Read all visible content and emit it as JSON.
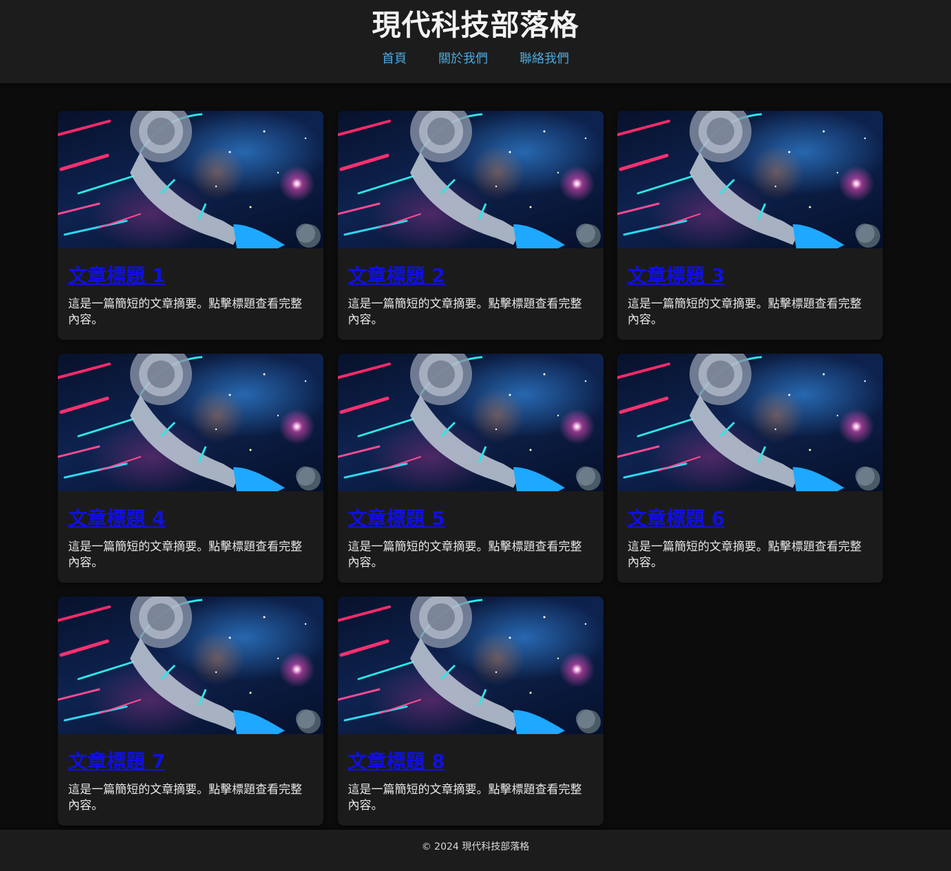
{
  "header": {
    "site_title": "現代科技部落格",
    "nav": [
      {
        "label": "首頁"
      },
      {
        "label": "關於我們"
      },
      {
        "label": "聯絡我們"
      }
    ]
  },
  "colors": {
    "header_bg": "#1c1c1c",
    "page_bg": "#0c0c0c",
    "card_bg": "#1b1b1b",
    "nav_link": "#4fa8dc",
    "post_link": "#1010e0"
  },
  "posts": [
    {
      "title": "文章標題 1",
      "excerpt": "這是一篇簡短的文章摘要。點擊標題查看完整內容。",
      "image": "astronaut-space-image"
    },
    {
      "title": "文章標題 2",
      "excerpt": "這是一篇簡短的文章摘要。點擊標題查看完整內容。",
      "image": "astronaut-space-image"
    },
    {
      "title": "文章標題 3",
      "excerpt": "這是一篇簡短的文章摘要。點擊標題查看完整內容。",
      "image": "astronaut-space-image"
    },
    {
      "title": "文章標題 4",
      "excerpt": "這是一篇簡短的文章摘要。點擊標題查看完整內容。",
      "image": "astronaut-space-image"
    },
    {
      "title": "文章標題 5",
      "excerpt": "這是一篇簡短的文章摘要。點擊標題查看完整內容。",
      "image": "astronaut-space-image"
    },
    {
      "title": "文章標題 6",
      "excerpt": "這是一篇簡短的文章摘要。點擊標題查看完整內容。",
      "image": "astronaut-space-image"
    },
    {
      "title": "文章標題 7",
      "excerpt": "這是一篇簡短的文章摘要。點擊標題查看完整內容。",
      "image": "astronaut-space-image"
    },
    {
      "title": "文章標題 8",
      "excerpt": "這是一篇簡短的文章摘要。點擊標題查看完整內容。",
      "image": "astronaut-space-image"
    }
  ],
  "footer": {
    "text": "© 2024 現代科技部落格"
  }
}
